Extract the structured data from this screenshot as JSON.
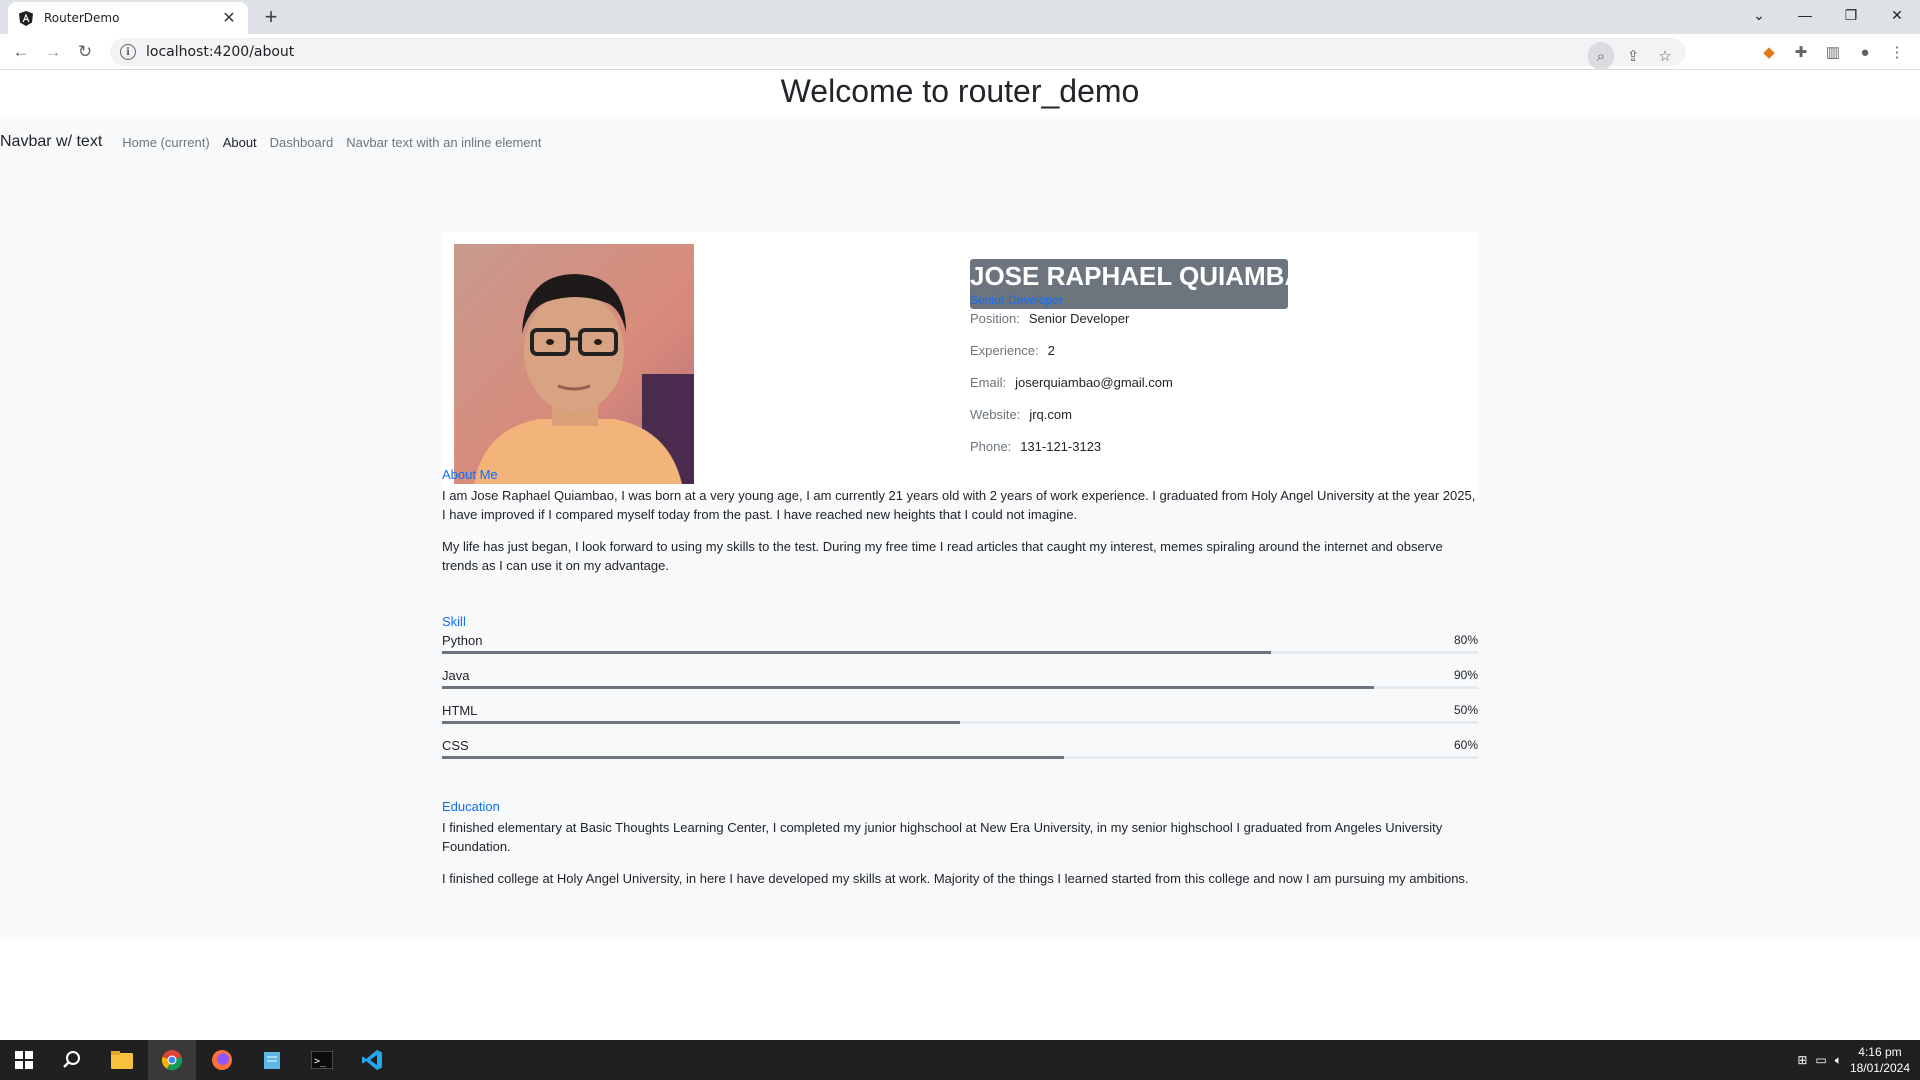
{
  "browser": {
    "tab_title": "RouterDemo",
    "url": "localhost:4200/about"
  },
  "page": {
    "title": "Welcome to router_demo"
  },
  "navbar": {
    "brand": "Navbar w/ text",
    "links": [
      "Home (current)",
      "About",
      "Dashboard"
    ],
    "text": "Navbar text with an inline element"
  },
  "profile": {
    "name": "JOSE RAPHAEL QUIAMBAO",
    "subtitle": "Senior Developer",
    "rows": [
      {
        "label": "Position:",
        "value": "Senior Developer"
      },
      {
        "label": "Experience:",
        "value": "2"
      },
      {
        "label": "Email:",
        "value": "joserquiambao@gmail.com"
      },
      {
        "label": "Website:",
        "value": "jrq.com"
      },
      {
        "label": "Phone:",
        "value": "131-121-3123"
      }
    ]
  },
  "about": {
    "heading": "About Me",
    "paragraphs": [
      "I am Jose Raphael Quiambao, I was born at a very young age, I am currently 21 years old with 2 years of work experience. I graduated from Holy Angel University at the year 2025, I have improved if I compared myself today from the past. I have reached new heights that I could not imagine.",
      "My life has just began, I look forward to using my skills to the test. During my free time I read articles that caught my interest, memes spiraling around the internet and observe trends as I can use it on my advantage."
    ]
  },
  "skills": {
    "heading": "Skill",
    "items": [
      {
        "name": "Python",
        "percent_label": "80%",
        "level": 0.8
      },
      {
        "name": "Java",
        "percent_label": "90%",
        "level": 0.9
      },
      {
        "name": "HTML",
        "percent_label": "50%",
        "level": 0.5
      },
      {
        "name": "CSS",
        "percent_label": "60%",
        "level": 0.6
      }
    ]
  },
  "education": {
    "heading": "Education",
    "paragraphs": [
      "I finished elementary at Basic Thoughts Learning Center, I completed my junior highschool at New Era University, in my senior highschool I graduated from Angeles University Foundation.",
      "I finished college at Holy Angel University, in here I have developed my skills at work. Majority of the things I learned started from this college and now I am pursuing my ambitions."
    ]
  },
  "taskbar": {
    "time": "4:16 pm",
    "date": "18/01/2024"
  },
  "colors": {
    "accent": "#0d6efd",
    "name_block": "#6c757d",
    "page_bg": "#f8f9fa"
  }
}
